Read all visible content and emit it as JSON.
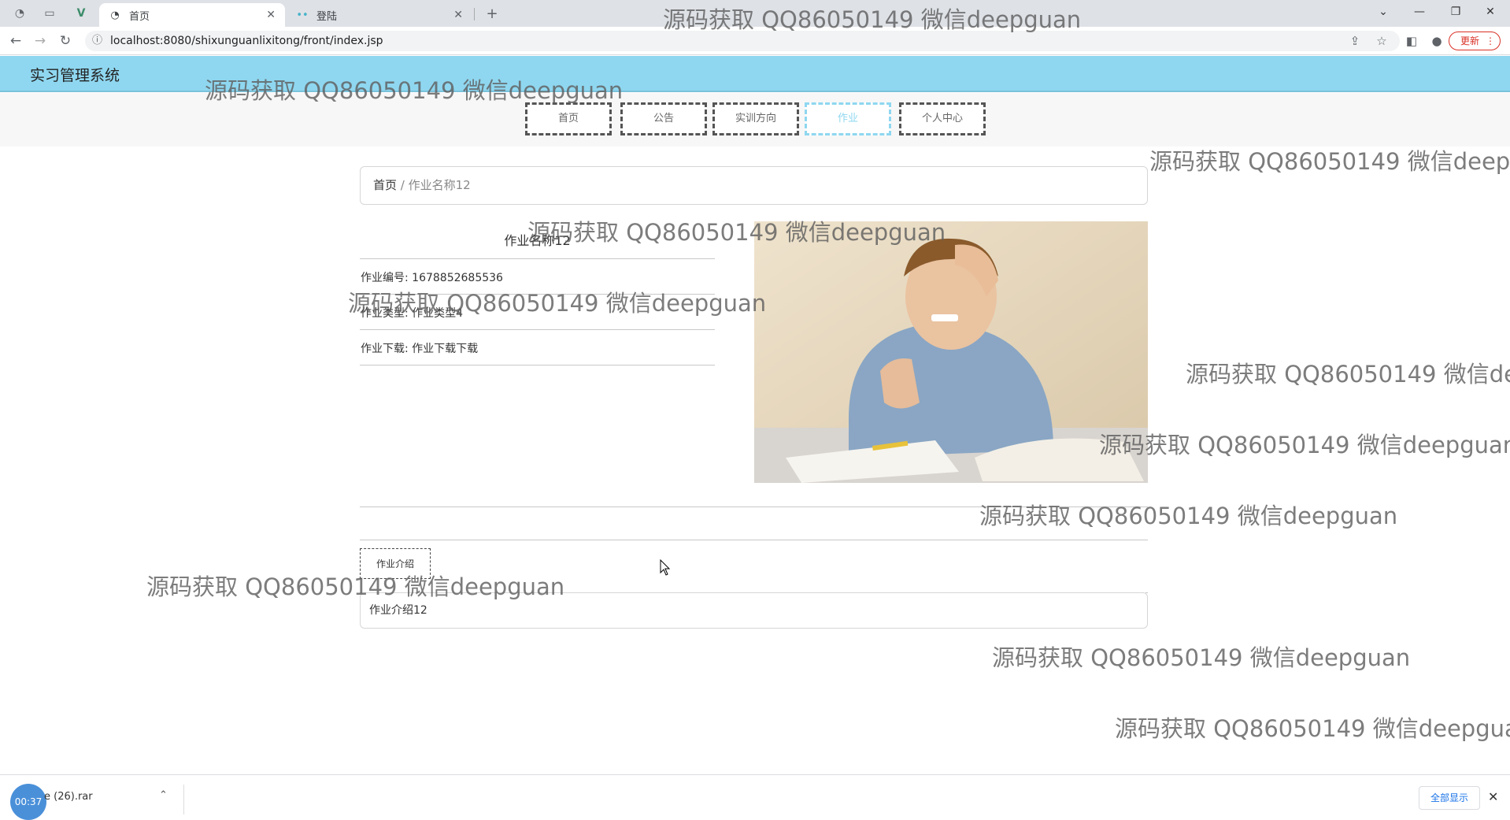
{
  "browser": {
    "tabs": [
      {
        "title": "首页",
        "active": true
      },
      {
        "title": "登陆",
        "active": false
      }
    ],
    "new_tab_symbol": "+",
    "url": "localhost:8080/shixunguanlixitong/front/index.jsp",
    "update_label": "更新"
  },
  "app": {
    "title": "实习管理系统",
    "nav": [
      "首页",
      "公告",
      "实训方向",
      "作业",
      "个人中心"
    ],
    "active_nav": "作业"
  },
  "breadcrumb": {
    "home": "首页",
    "separator": "/",
    "current": "作业名称12"
  },
  "detail": {
    "title": "作业名称12",
    "rows": [
      {
        "label": "作业编号:",
        "value": "1678852685536"
      },
      {
        "label": "作业类型:",
        "value": "作业类型4"
      },
      {
        "label": "作业下载:",
        "value": "作业下载下载"
      }
    ],
    "intro_tab": "作业介绍",
    "intro_text": "作业介绍12"
  },
  "download_bar": {
    "timer": "00:37",
    "file_name": "e (26).rar",
    "show_all": "全部显示"
  },
  "watermark": "源码获取 QQ86050149 微信deepguan",
  "colors": {
    "header_bg": "#8fd7f0",
    "active_nav": "#8fd7f0",
    "tabstrip": "#dee1e6"
  }
}
